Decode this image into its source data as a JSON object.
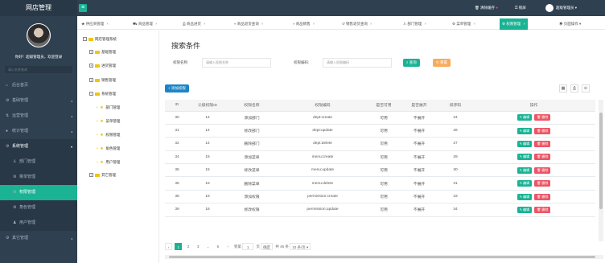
{
  "app": {
    "title": "网店管理"
  },
  "user": {
    "welcome": "你好！超级管理员，欢迎登录",
    "search_placeholder": "请以名称查询",
    "name": "超级管理员"
  },
  "topbar": {
    "clear_cache": "清除缓存",
    "lock": "锁屏"
  },
  "sidebar": {
    "items": [
      {
        "label": "后台首页",
        "icon": "home-icon"
      },
      {
        "label": "基础管理",
        "icon": "gear-icon"
      },
      {
        "label": "运营管理",
        "icon": "chart-icon"
      },
      {
        "label": "统计管理",
        "icon": "stats-icon"
      },
      {
        "label": "系统管理",
        "icon": "gears-icon"
      }
    ],
    "sub_items": [
      {
        "label": "部门管理",
        "icon": "user-icon"
      },
      {
        "label": "菜单管理",
        "icon": "gear-icon"
      },
      {
        "label": "权限管理",
        "icon": "gear-icon"
      },
      {
        "label": "角色管理",
        "icon": "gear-icon"
      },
      {
        "label": "用户管理",
        "icon": "user-icon"
      }
    ],
    "other": {
      "label": "其它管理",
      "icon": "gear-icon"
    }
  },
  "tabs": [
    {
      "label": "供应商管理",
      "icon": "star-icon"
    },
    {
      "label": "商品管理",
      "icon": "cart-icon"
    },
    {
      "label": "商品进货",
      "icon": "box-icon"
    },
    {
      "label": "商品退货查询",
      "icon": "back-icon"
    },
    {
      "label": "商品销售",
      "icon": "forward-icon"
    },
    {
      "label": "销售退货查询",
      "icon": "return-icon"
    },
    {
      "label": "部门管理",
      "icon": "user-icon"
    },
    {
      "label": "菜单管理",
      "icon": "gear-icon"
    },
    {
      "label": "权限管理",
      "icon": "gear-icon"
    }
  ],
  "page_ops": "页面操作",
  "tree": {
    "root": "网店管理系统",
    "groups": [
      "基础管理",
      "进货管理",
      "销售管理",
      "系统管理",
      "其它管理"
    ],
    "system_children": [
      "部门管理",
      "菜单管理",
      "权限管理",
      "角色管理",
      "用户管理"
    ]
  },
  "search": {
    "title": "搜索条件",
    "label_name": "权限名称:",
    "placeholder_name": "请输入权限名称",
    "label_code": "权限编码:",
    "placeholder_code": "请输入权限编码",
    "search_btn": "查询",
    "reset_btn": "重置"
  },
  "add_btn": "添加权限",
  "table": {
    "headers": [
      "ID",
      "父级权限ID",
      "权限名称",
      "权限编码",
      "是否可用",
      "是否展开",
      "排序码",
      "操作"
    ],
    "rows": [
      [
        "30",
        "14",
        "添加部门",
        "dept:create",
        "可用",
        "不展开",
        "24"
      ],
      [
        "31",
        "14",
        "修改部门",
        "dept:update",
        "可用",
        "不展开",
        "26"
      ],
      [
        "32",
        "14",
        "删除部门",
        "dept:delete",
        "可用",
        "不展开",
        "27"
      ],
      [
        "34",
        "15",
        "添加菜单",
        "menu:create",
        "可用",
        "不展开",
        "29"
      ],
      [
        "35",
        "15",
        "修改菜单",
        "menu:update",
        "可用",
        "不展开",
        "30"
      ],
      [
        "36",
        "15",
        "删除菜单",
        "menu:delete",
        "可用",
        "不展开",
        "31"
      ],
      [
        "38",
        "16",
        "添加权限",
        "permission:create",
        "可用",
        "不展开",
        "33"
      ],
      [
        "39",
        "16",
        "修改权限",
        "permission:update",
        "可用",
        "不展开",
        "34"
      ]
    ],
    "edit": "编辑",
    "delete": "删除"
  },
  "pager": {
    "pages": [
      "1",
      "2",
      "3",
      "...",
      "5"
    ],
    "goto": "到第",
    "page_input": "1",
    "page_unit": "页",
    "confirm": "确定",
    "total": "共 45 条",
    "per_page": "10 条/页"
  },
  "colors": {
    "primary": "#1ab394",
    "warning": "#f8ac59",
    "danger": "#ed5565",
    "info": "#1c84c6",
    "sidebar": "#2f4050"
  }
}
